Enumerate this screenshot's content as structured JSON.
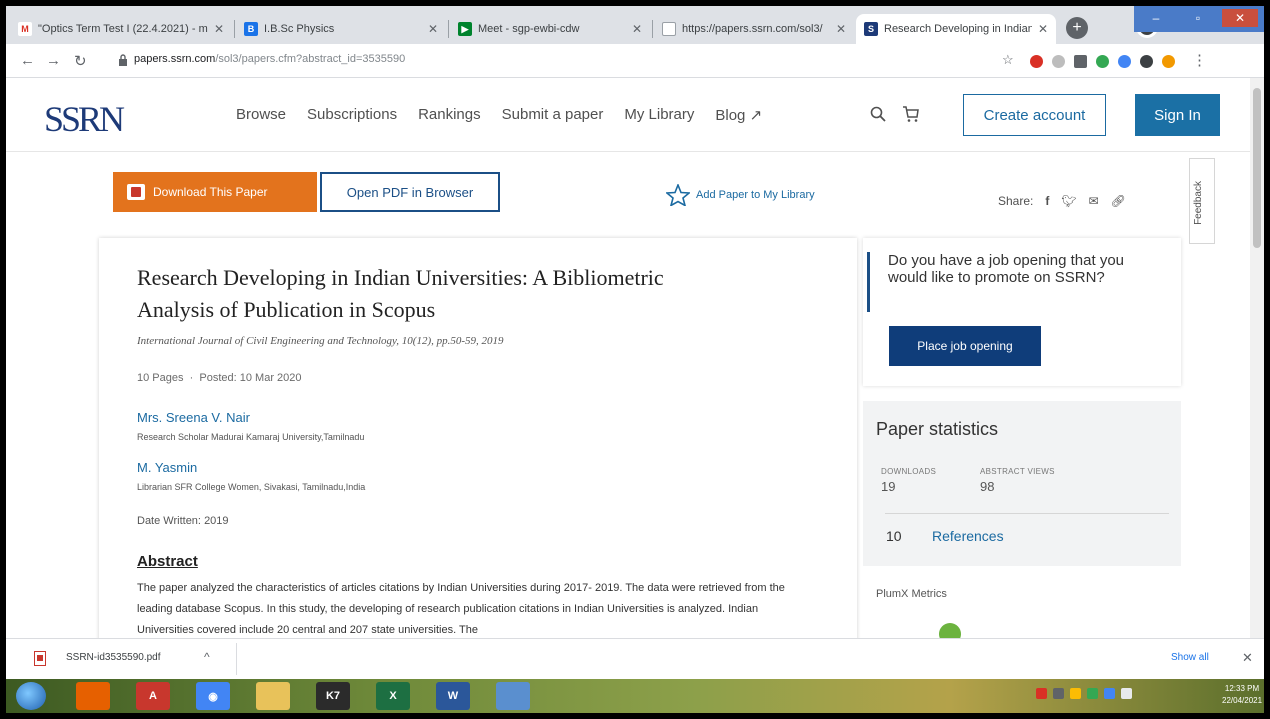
{
  "browser": {
    "tabs": [
      {
        "title": "\"Optics Term Test I (22.4.2021) - m",
        "favicon_color": "#d93025",
        "favicon_text": "M"
      },
      {
        "title": "I.B.Sc Physics",
        "favicon_color": "#1a73e8",
        "favicon_text": "B"
      },
      {
        "title": "Meet - sgp-ewbi-cdw",
        "favicon_color": "#00832d",
        "favicon_text": "M"
      },
      {
        "title": "https://papers.ssrn.com/sol3/",
        "favicon_color": "#ffffff",
        "favicon_text": ""
      },
      {
        "title": "Research Developing in Indian",
        "favicon_color": "#1d3a78",
        "favicon_text": "S"
      }
    ],
    "url_host": "papers.ssrn.com",
    "url_path": "/sol3/papers.cfm?abstract_id=3535590"
  },
  "ssrn": {
    "logo": "SSRN",
    "nav": [
      "Browse",
      "Subscriptions",
      "Rankings",
      "Submit a paper",
      "My Library",
      "Blog ↗"
    ],
    "create_account": "Create account",
    "sign_in": "Sign In",
    "download_btn": "Download This Paper",
    "open_pdf_btn": "Open PDF in Browser",
    "add_library": "Add Paper to My Library",
    "share_label": "Share:",
    "feedback": "Feedback"
  },
  "paper": {
    "title": "Research Developing in Indian Universities: A Bibliometric Analysis of Publication in Scopus",
    "citation": "International Journal of Civil Engineering and Technology, 10(12), pp.50-59, 2019",
    "pages": "10 Pages",
    "posted": "Posted: 10 Mar 2020",
    "authors": [
      {
        "name": "Mrs. Sreena V. Nair",
        "affiliation": "Research Scholar Madurai Kamaraj University,Tamilnadu"
      },
      {
        "name": "M. Yasmin",
        "affiliation": "Librarian SFR College Women, Sivakasi, Tamilnadu,India"
      }
    ],
    "date_written_label": "Date Written:",
    "date_written": "2019",
    "abstract_heading": "Abstract",
    "abstract_text": "The paper analyzed the characteristics of articles citations by Indian Universities during 2017- 2019. The data were retrieved from the leading database Scopus. In this study, the developing of research publication citations in Indian Universities is analyzed. Indian Universities covered include 20 central and 207 state universities. The"
  },
  "sidebar": {
    "job_question": "Do you have a job opening that you would like to promote on SSRN?",
    "job_button": "Place job opening",
    "stats_heading": "Paper statistics",
    "downloads_label": "DOWNLOADS",
    "downloads": "19",
    "abstract_views_label": "ABSTRACT VIEWS",
    "abstract_views": "98",
    "references_count": "10",
    "references_label": "References",
    "plumx": "PlumX Metrics"
  },
  "download_bar": {
    "filename": "SSRN-id3535590.pdf",
    "show_all": "Show all"
  },
  "taskbar": {
    "time": "12:33 PM",
    "date": "22/04/2021"
  },
  "colors": {
    "ssrn_blue": "#1b6aa1",
    "download_orange": "#e3731d",
    "job_button": "#0f3d7a"
  }
}
